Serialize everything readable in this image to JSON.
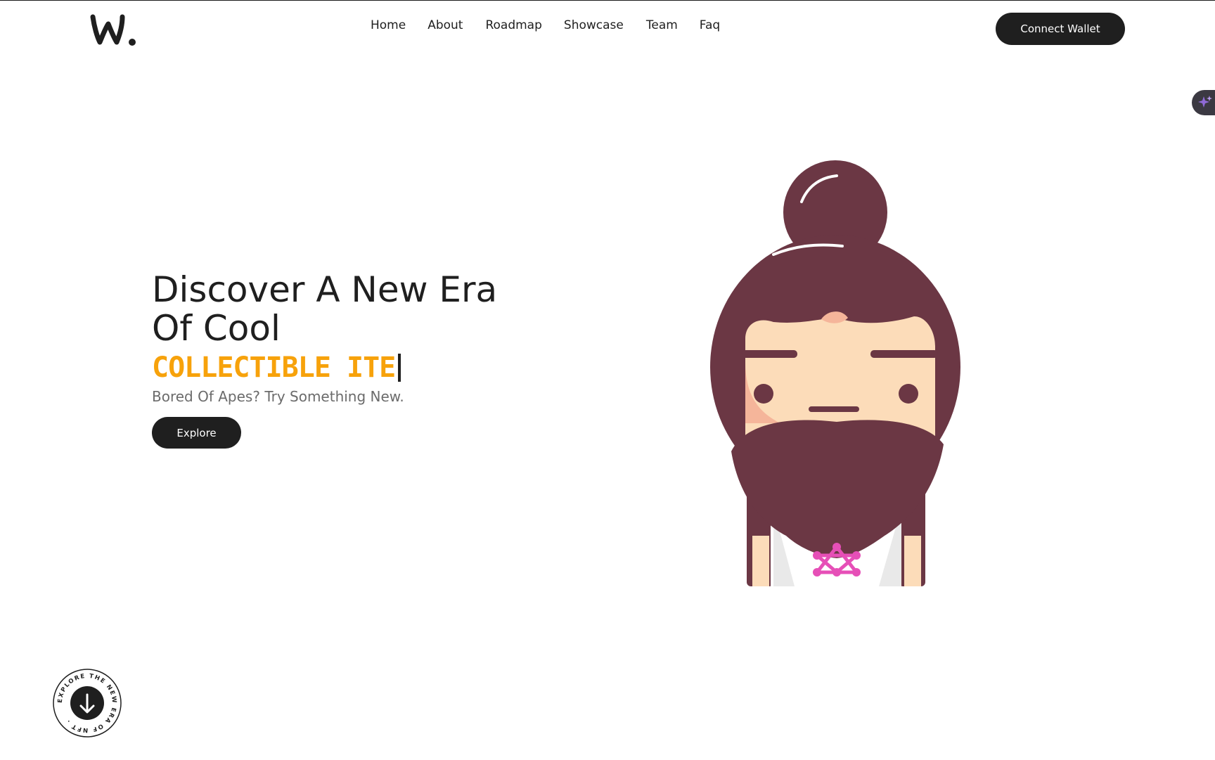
{
  "header": {
    "logo_text": "w.",
    "nav": [
      "Home",
      "About",
      "Roadmap",
      "Showcase",
      "Team",
      "Faq"
    ],
    "connect_label": "Connect Wallet"
  },
  "hero": {
    "title": "Discover A New Era Of Cool",
    "typed_text": "COLLECTIBLE ITE",
    "subtitle": "Bored Of Apes? Try Something New.",
    "explore_label": "Explore",
    "figure_alt": "avatar-bearded-character"
  },
  "scroll_badge": {
    "ring_text": "EXPLORE THE NEW ERA OF NFT . "
  },
  "colors": {
    "text": "#1f1f1f",
    "accent_orange": "#f7a20b",
    "muted": "#6b6b6b",
    "hair": "#6b3744",
    "skin": "#fcdcb9",
    "network_pink": "#e64fb7"
  },
  "icons": {
    "side_tab": "sparkle-icon",
    "scroll_arrow": "arrow-down-icon"
  }
}
